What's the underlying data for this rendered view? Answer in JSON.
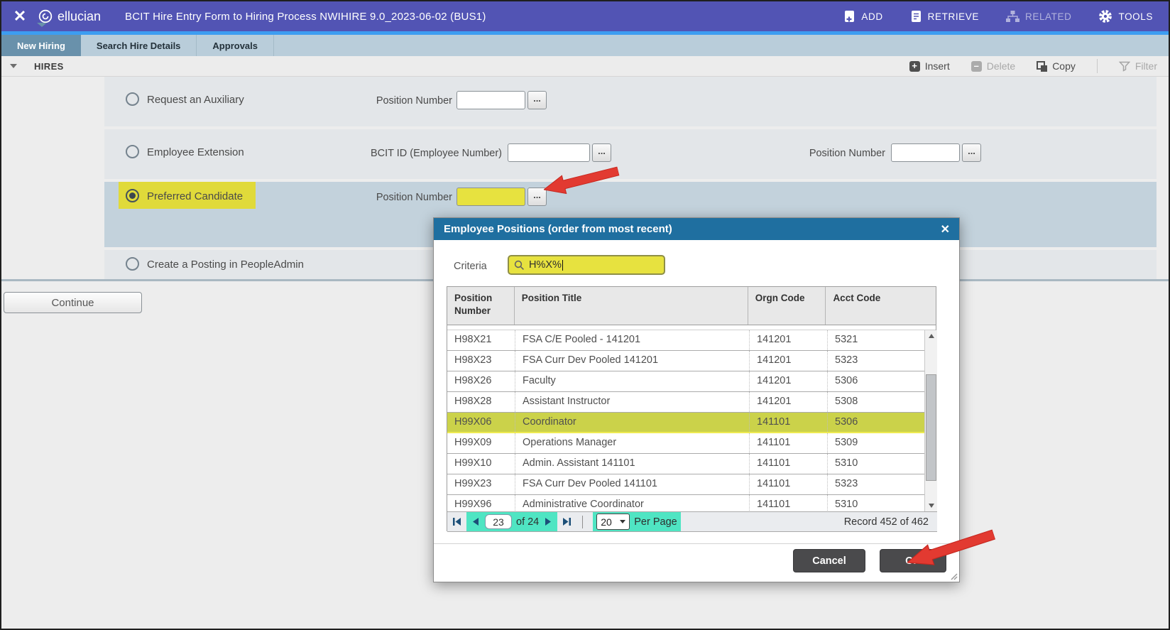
{
  "icons": {
    "close": "✕",
    "dots": "..."
  },
  "topbar": {
    "brand": "ellucian",
    "title": "BCIT Hire Entry Form to Hiring Process NWIHIRE 9.0_2023-06-02 (BUS1)",
    "actions": [
      {
        "label": "ADD"
      },
      {
        "label": "RETRIEVE"
      },
      {
        "label": "RELATED",
        "disabled": true
      },
      {
        "label": "TOOLS"
      }
    ]
  },
  "tabs": [
    {
      "label": "New Hiring",
      "active": true
    },
    {
      "label": "Search Hire Details"
    },
    {
      "label": "Approvals"
    }
  ],
  "section": {
    "title": "HIRES",
    "toolbar": [
      "Insert",
      "Delete",
      "Copy",
      "Filter"
    ]
  },
  "form": {
    "options": [
      {
        "label": "Request an Auxiliary",
        "fields": [
          {
            "label": "Position Number",
            "value": ""
          }
        ]
      },
      {
        "label": "Employee Extension",
        "fields": [
          {
            "label": "BCIT ID (Employee Number)",
            "value": ""
          },
          {
            "label": "Position Number",
            "value": ""
          }
        ]
      },
      {
        "label": "Preferred Candidate",
        "selected": true,
        "highlighted": true,
        "fields": [
          {
            "label": "Position Number",
            "value": "",
            "highlighted": true
          }
        ]
      },
      {
        "label": "Create a Posting in PeopleAdmin",
        "fields": []
      }
    ],
    "continue_label": "Continue"
  },
  "dialog": {
    "title": "Employee Positions (order from most recent)",
    "criteria_label": "Criteria",
    "criteria_value": "H%X%",
    "table": {
      "columns": [
        "Position Number",
        "Position Title",
        "Orgn Code",
        "Acct Code"
      ],
      "rows": [
        [
          "H98X21",
          "FSA C/E Pooled - 141201",
          "141201",
          "5321"
        ],
        [
          "H98X23",
          "FSA Curr Dev Pooled 141201",
          "141201",
          "5323"
        ],
        [
          "H98X26",
          "Faculty",
          "141201",
          "5306"
        ],
        [
          "H98X28",
          "Assistant Instructor",
          "141201",
          "5308"
        ],
        [
          "H99X06",
          "Coordinator",
          "141101",
          "5306"
        ],
        [
          "H99X09",
          "Operations Manager",
          "141101",
          "5309"
        ],
        [
          "H99X10",
          "Admin. Assistant 141101",
          "141101",
          "5310"
        ],
        [
          "H99X23",
          "FSA Curr Dev Pooled 141101",
          "141101",
          "5323"
        ],
        [
          "H99X96",
          "Administrative Coordinator",
          "141101",
          "5310"
        ]
      ],
      "highlighted_row_index": 4
    },
    "pagination": {
      "page": "23",
      "of_label": "of 24",
      "per_page_value": "20",
      "per_page_label": "Per Page",
      "record": "Record 452 of 462"
    },
    "cancel_label": "Cancel",
    "ok_label": "OK"
  },
  "colors": {
    "topbar": "#5254b4",
    "accent_strip": "#3d9df1",
    "active_tab": "#6991ab",
    "dialog_header": "#1f6fa0",
    "highlight_yellow": "#e7e23f",
    "highlight_row": "#cbd24a",
    "teal_highlight": "#4fe5c3",
    "selected_band": "#c3d2dc",
    "arrow_red": "#e23a31",
    "button_dark": "#4a4a4c"
  }
}
